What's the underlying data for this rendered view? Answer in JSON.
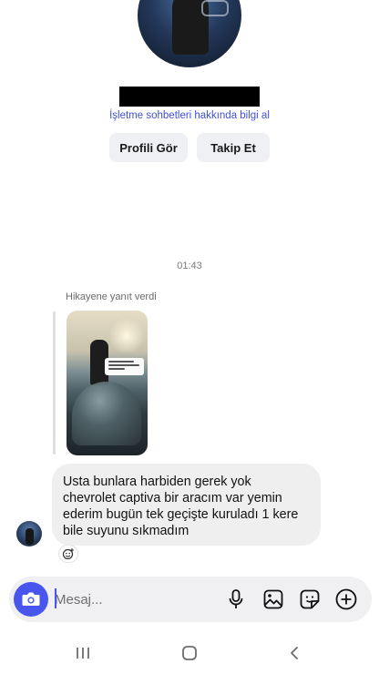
{
  "profile": {
    "info_link": "İşletme sohbetleri hakkında bilgi al",
    "view_profile_label": "Profili Gör",
    "follow_label": "Takip Et"
  },
  "chat": {
    "time_separator": "01:43",
    "story_reply_label": "Hikayene yanıt verdi",
    "message_text": "Usta bunlara harbiden gerek yok\nchevrolet captiva bir aracım var yemin\nederim bugün tek geçişte kuruladı 1 kere\nbile suyunu sıkmadım"
  },
  "composer": {
    "placeholder": "Mesaj...",
    "accent_color": "#4856ee"
  },
  "icons": {
    "camera": "camera-icon",
    "mic": "microphone-icon",
    "gallery": "gallery-icon",
    "sticker": "sticker-icon",
    "plus": "plus-icon",
    "reaction": "add-reaction-icon"
  }
}
